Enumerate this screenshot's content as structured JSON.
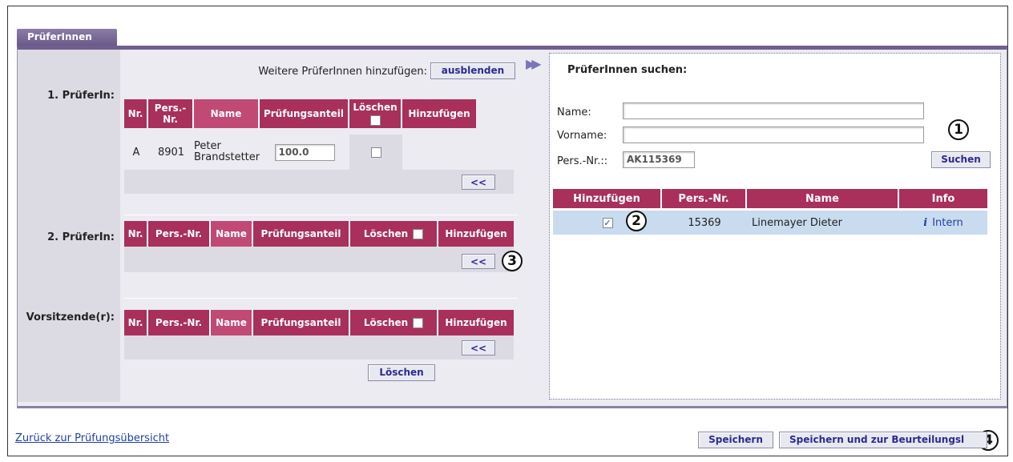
{
  "tab": {
    "label": "PrüferInnen"
  },
  "top": {
    "weitere_label": "Weitere PrüferInnen hinzufügen:",
    "ausblenden_label": "ausblenden"
  },
  "section1": {
    "label": "1. PrüferIn:",
    "headers": {
      "nr": "Nr.",
      "persnr": "Pers.-Nr.",
      "name": "Name",
      "anteil": "Prüfungsanteil",
      "loeschen": "Löschen",
      "hinzufuegen": "Hinzufügen"
    },
    "row": {
      "nr": "A",
      "persnr": "8901",
      "name_line1": "Peter",
      "name_line2": "Brandstetter",
      "anteil": "100.0"
    },
    "move_label": "<<"
  },
  "section2": {
    "label": "2. PrüferIn:",
    "headers": {
      "nr": "Nr.",
      "persnr": "Pers.-Nr.",
      "name": "Name",
      "anteil": "Prüfungsanteil",
      "loeschen": "Löschen",
      "hinzufuegen": "Hinzufügen"
    },
    "move_label": "<<"
  },
  "section3": {
    "label": "Vorsitzende(r):",
    "headers": {
      "nr": "Nr.",
      "persnr": "Pers.-Nr.",
      "name": "Name",
      "anteil": "Prüfungsanteil",
      "loeschen": "Löschen",
      "hinzufuegen": "Hinzufügen"
    },
    "move_label": "<<",
    "loeschen_button": "Löschen"
  },
  "search": {
    "title": "PrüferInnen suchen:",
    "name_label": "Name:",
    "name_value": "",
    "vorname_label": "Vorname:",
    "vorname_value": "",
    "persnr_label": "Pers.-Nr.::",
    "persnr_value": "AK115369",
    "suchen_label": "Suchen"
  },
  "results": {
    "headers": {
      "hinzufuegen": "Hinzufügen",
      "persnr": "Pers.-Nr.",
      "name": "Name",
      "info": "Info"
    },
    "rows": [
      {
        "checked": true,
        "persnr": "15369",
        "name": "Linemayer Dieter",
        "info": "Intern"
      }
    ]
  },
  "footer": {
    "back_link": "Zurück zur Prüfungsübersicht",
    "save_label": "Speichern",
    "save_next_label": "Speichern und zur Beurteilungsl"
  },
  "markers": {
    "m1": "1",
    "m2": "2",
    "m3": "3",
    "m4": "4"
  },
  "colors": {
    "header_bg": "#a8305a",
    "tab_bg": "#6a5a89",
    "result_row_bg": "#c9dcef",
    "link": "#1f3fa8"
  }
}
